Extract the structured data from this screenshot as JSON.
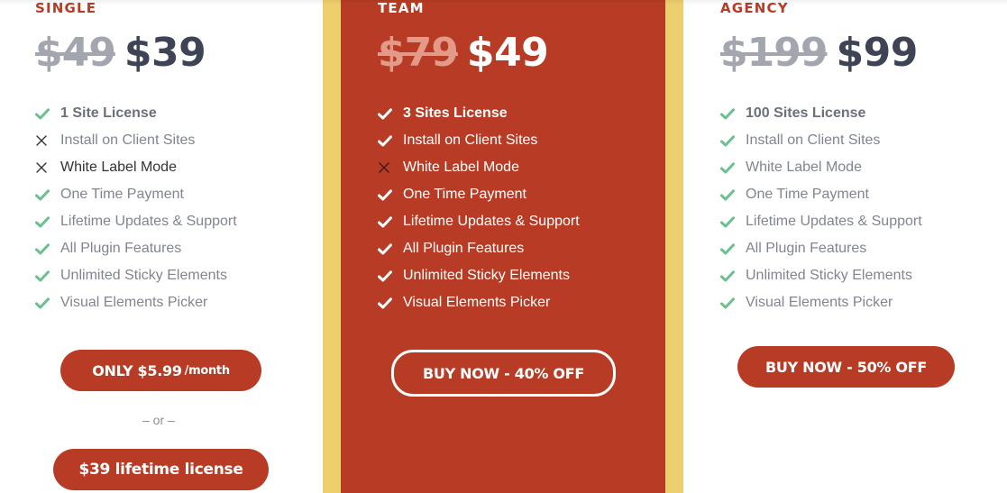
{
  "colors": {
    "accent": "#b83c25",
    "highlight_frame": "#eecf6d",
    "check_green": "#6cc08f",
    "price_dark": "#3e4455",
    "price_struck": "#a3a6ae"
  },
  "plans": [
    {
      "name": "SINGLE",
      "old_price": "$49",
      "new_price": "$39",
      "features": [
        {
          "label": "1 Site License",
          "included": true,
          "icon": "check-icon"
        },
        {
          "label": "Install on Client Sites",
          "included": false,
          "icon": "x-icon"
        },
        {
          "label": "White Label Mode",
          "included": false,
          "icon": "x-icon"
        },
        {
          "label": "One Time Payment",
          "included": true,
          "icon": "check-icon"
        },
        {
          "label": "Lifetime Updates & Support",
          "included": true,
          "icon": "check-icon"
        },
        {
          "label": "All Plugin Features",
          "included": true,
          "icon": "check-icon"
        },
        {
          "label": "Unlimited Sticky Elements",
          "included": true,
          "icon": "check-icon"
        },
        {
          "label": "Visual Elements Picker",
          "included": true,
          "icon": "check-icon"
        }
      ],
      "buttons": [
        {
          "label": "ONLY $5.99",
          "suffix": "/month"
        },
        {
          "label": "$39 lifetime license"
        }
      ],
      "separator": "– or –"
    },
    {
      "name": "TEAM",
      "old_price": "$79",
      "new_price": "$49",
      "features": [
        {
          "label": "3 Sites License",
          "included": true,
          "icon": "check-icon"
        },
        {
          "label": "Install on Client Sites",
          "included": true,
          "icon": "check-icon"
        },
        {
          "label": "White Label Mode",
          "included": false,
          "icon": "x-icon"
        },
        {
          "label": "One Time Payment",
          "included": true,
          "icon": "check-icon"
        },
        {
          "label": "Lifetime Updates & Support",
          "included": true,
          "icon": "check-icon"
        },
        {
          "label": "All Plugin Features",
          "included": true,
          "icon": "check-icon"
        },
        {
          "label": "Unlimited Sticky Elements",
          "included": true,
          "icon": "check-icon"
        },
        {
          "label": "Visual Elements Picker",
          "included": true,
          "icon": "check-icon"
        }
      ],
      "buttons": [
        {
          "label": "BUY NOW - 40% OFF"
        }
      ]
    },
    {
      "name": "AGENCY",
      "old_price": "$199",
      "new_price": "$99",
      "features": [
        {
          "label": "100 Sites License",
          "included": true,
          "icon": "check-icon"
        },
        {
          "label": "Install on Client Sites",
          "included": true,
          "icon": "check-icon"
        },
        {
          "label": "White Label Mode",
          "included": true,
          "icon": "check-icon"
        },
        {
          "label": "One Time Payment",
          "included": true,
          "icon": "check-icon"
        },
        {
          "label": "Lifetime Updates & Support",
          "included": true,
          "icon": "check-icon"
        },
        {
          "label": "All Plugin Features",
          "included": true,
          "icon": "check-icon"
        },
        {
          "label": "Unlimited Sticky Elements",
          "included": true,
          "icon": "check-icon"
        },
        {
          "label": "Visual Elements Picker",
          "included": true,
          "icon": "check-icon"
        }
      ],
      "buttons": [
        {
          "label": "BUY NOW - 50% OFF"
        }
      ]
    }
  ]
}
